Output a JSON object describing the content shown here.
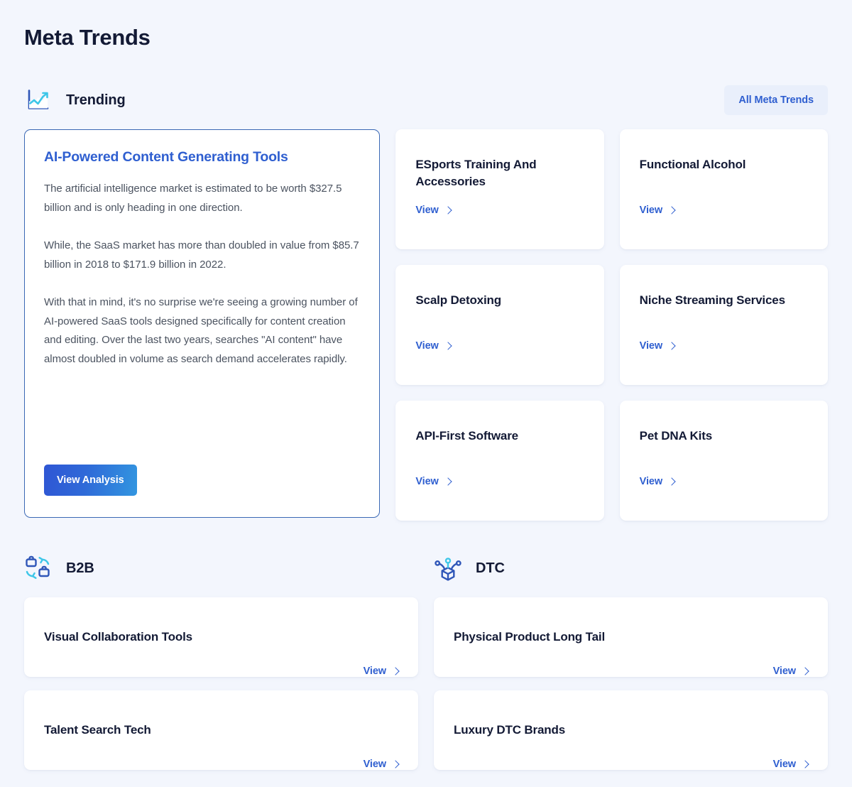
{
  "page": {
    "title": "Meta Trends"
  },
  "trending": {
    "icon": "trending-chart-icon",
    "label": "Trending",
    "all_button": "All Meta Trends",
    "featured": {
      "title": "AI-Powered Content Generating Tools",
      "paragraph1": "The artificial intelligence market is estimated to be worth $327.5 billion and is only heading in one direction.",
      "paragraph2": "While, the SaaS market has more than doubled in value from $85.7 billion in 2018 to $171.9 billion in 2022.",
      "paragraph3": "With that in mind, it's no surprise we're seeing a growing number of AI-powered SaaS tools designed specifically for content creation and editing. Over the last two years, searches \"AI content\" have almost doubled in volume as search demand accelerates rapidly.",
      "cta": "View Analysis"
    },
    "cards": [
      {
        "title": "ESports Training And Accessories",
        "view": "View"
      },
      {
        "title": "Functional Alcohol",
        "view": "View"
      },
      {
        "title": "Scalp Detoxing",
        "view": "View"
      },
      {
        "title": "Niche Streaming Services",
        "view": "View"
      },
      {
        "title": "API-First Software",
        "view": "View"
      },
      {
        "title": "Pet DNA Kits",
        "view": "View"
      }
    ]
  },
  "b2b": {
    "icon": "briefcase-exchange-icon",
    "label": "B2B",
    "cards": [
      {
        "title": "Visual Collaboration Tools",
        "view": "View"
      },
      {
        "title": "Talent Search Tech",
        "view": "View"
      }
    ]
  },
  "dtc": {
    "icon": "package-network-icon",
    "label": "DTC",
    "cards": [
      {
        "title": "Physical Product Long Tail",
        "view": "View"
      },
      {
        "title": "Luxury DTC Brands",
        "view": "View"
      }
    ]
  },
  "colors": {
    "background": "#f3f6fd",
    "accent_blue": "#2f5fd0",
    "dark_navy": "#131a35",
    "icon_cyan": "#3ec6e8",
    "border_blue": "#3a68b4",
    "chip_bg": "#e9effb"
  }
}
